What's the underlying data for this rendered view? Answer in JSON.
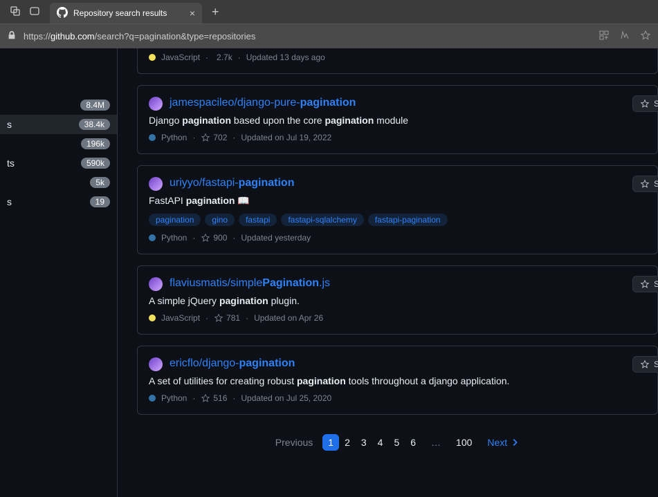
{
  "browser": {
    "tab_title": "Repository search results",
    "url_pre": "https://",
    "url_host": "github.com",
    "url_path": "/search?q=pagination&type=repositories"
  },
  "sidebar": {
    "items": [
      {
        "label": "",
        "count": "8.4M"
      },
      {
        "label": "s",
        "count": "38.4k"
      },
      {
        "label": "",
        "count": "196k"
      },
      {
        "label": "ts",
        "count": "590k"
      },
      {
        "label": "",
        "count": "5k"
      },
      {
        "label": "s",
        "count": "19"
      }
    ]
  },
  "partial": {
    "lang": "JavaScript",
    "lang_color": "#f1e05a",
    "stars": "2.7k",
    "updated": "Updated 13 days ago"
  },
  "results": [
    {
      "owner": "jamespacileo",
      "sep": "/",
      "name_pre": "django-pure-",
      "name_hl": "pagination",
      "desc_parts": [
        "Django ",
        "pagination",
        " based upon the core ",
        "pagination",
        " module"
      ],
      "lang": "Python",
      "lang_color": "#3572A5",
      "stars": "702",
      "updated": "Updated on Jul 19, 2022",
      "topics": [],
      "star_label": "Star"
    },
    {
      "owner": "uriyyo",
      "sep": "/",
      "name_pre": "fastapi-",
      "name_hl": "pagination",
      "desc_parts": [
        "FastAPI ",
        "pagination",
        " 📖"
      ],
      "lang": "Python",
      "lang_color": "#3572A5",
      "stars": "900",
      "updated": "Updated yesterday",
      "topics": [
        "pagination",
        "gino",
        "fastapi",
        "fastapi-sqlalchemy",
        "fastapi-pagination"
      ],
      "star_label": "Star"
    },
    {
      "owner": "flaviusmatis",
      "sep": "/",
      "name_pre": "simple",
      "name_hl": "Pagination",
      "name_post": ".js",
      "desc_parts": [
        "A simple jQuery ",
        "pagination",
        " plugin."
      ],
      "lang": "JavaScript",
      "lang_color": "#f1e05a",
      "stars": "781",
      "updated": "Updated on Apr 26",
      "topics": [],
      "star_label": "Star"
    },
    {
      "owner": "ericflo",
      "sep": "/",
      "name_pre": "django-",
      "name_hl": "pagination",
      "desc_parts": [
        "A set of utilities for creating robust ",
        "pagination",
        " tools throughout a django application."
      ],
      "lang": "Python",
      "lang_color": "#3572A5",
      "stars": "516",
      "updated": "Updated on Jul 25, 2020",
      "topics": [],
      "star_label": "Star"
    }
  ],
  "pagination": {
    "prev": "Previous",
    "pages": [
      "1",
      "2",
      "3",
      "4",
      "5",
      "6"
    ],
    "ellipsis": "…",
    "last": "100",
    "next": "Next"
  }
}
